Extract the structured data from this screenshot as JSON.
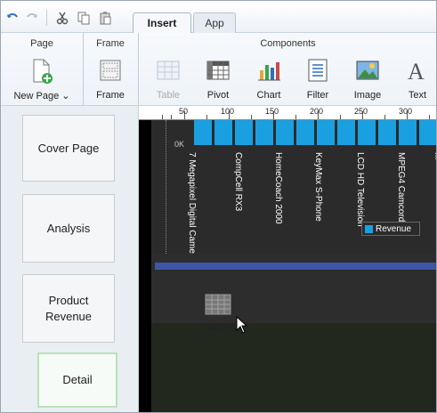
{
  "toolbar": {
    "icons": [
      "undo-icon",
      "redo-icon",
      "cut-icon",
      "copy-icon",
      "paste-icon"
    ]
  },
  "tabs": [
    {
      "label": "Insert",
      "active": true
    },
    {
      "label": "App",
      "active": false
    }
  ],
  "ribbon": {
    "groups": {
      "page": "Page",
      "frame": "Frame",
      "components": "Components"
    },
    "buttons": {
      "new_page": "New Page",
      "frame": "Frame",
      "table": "Table",
      "pivot": "Pivot",
      "chart": "Chart",
      "filter": "Filter",
      "image": "Image",
      "text": "Text"
    }
  },
  "pages": [
    {
      "label": "Cover Page",
      "selected": false
    },
    {
      "label": "Analysis",
      "selected": false
    },
    {
      "label": "Product Revenue",
      "selected": false
    },
    {
      "label": "Detail",
      "selected": true
    }
  ],
  "ruler": {
    "ticks": [
      "50",
      "100",
      "150",
      "200",
      "250",
      "300"
    ]
  },
  "chart_data": {
    "type": "bar",
    "zero_label": "0K",
    "categories": [
      "7 Megapixel Digital Camer",
      "CompCell RX3",
      "HomeCoach 2000",
      "KeyMax S-Phone",
      "LCD HD Television",
      "MPEG4 Camcorder",
      "..."
    ],
    "legend": [
      {
        "name": "Revenue",
        "color": "#1aa0e0"
      }
    ]
  },
  "drag": {
    "label": "Table"
  },
  "colors": {
    "bar": "#1aa0e0",
    "band": "#3f56a5",
    "selected_border": "#b8e3b8"
  }
}
